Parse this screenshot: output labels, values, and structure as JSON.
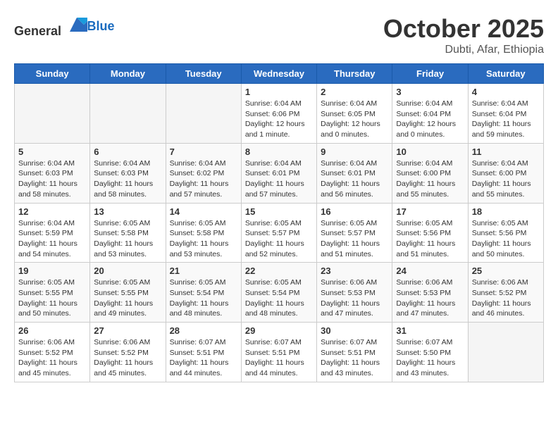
{
  "header": {
    "logo_general": "General",
    "logo_blue": "Blue",
    "month_title": "October 2025",
    "location": "Dubti, Afar, Ethiopia"
  },
  "days_of_week": [
    "Sunday",
    "Monday",
    "Tuesday",
    "Wednesday",
    "Thursday",
    "Friday",
    "Saturday"
  ],
  "weeks": [
    [
      {
        "day": "",
        "info": ""
      },
      {
        "day": "",
        "info": ""
      },
      {
        "day": "",
        "info": ""
      },
      {
        "day": "1",
        "info": "Sunrise: 6:04 AM\nSunset: 6:06 PM\nDaylight: 12 hours\nand 1 minute."
      },
      {
        "day": "2",
        "info": "Sunrise: 6:04 AM\nSunset: 6:05 PM\nDaylight: 12 hours\nand 0 minutes."
      },
      {
        "day": "3",
        "info": "Sunrise: 6:04 AM\nSunset: 6:04 PM\nDaylight: 12 hours\nand 0 minutes."
      },
      {
        "day": "4",
        "info": "Sunrise: 6:04 AM\nSunset: 6:04 PM\nDaylight: 11 hours\nand 59 minutes."
      }
    ],
    [
      {
        "day": "5",
        "info": "Sunrise: 6:04 AM\nSunset: 6:03 PM\nDaylight: 11 hours\nand 58 minutes."
      },
      {
        "day": "6",
        "info": "Sunrise: 6:04 AM\nSunset: 6:03 PM\nDaylight: 11 hours\nand 58 minutes."
      },
      {
        "day": "7",
        "info": "Sunrise: 6:04 AM\nSunset: 6:02 PM\nDaylight: 11 hours\nand 57 minutes."
      },
      {
        "day": "8",
        "info": "Sunrise: 6:04 AM\nSunset: 6:01 PM\nDaylight: 11 hours\nand 57 minutes."
      },
      {
        "day": "9",
        "info": "Sunrise: 6:04 AM\nSunset: 6:01 PM\nDaylight: 11 hours\nand 56 minutes."
      },
      {
        "day": "10",
        "info": "Sunrise: 6:04 AM\nSunset: 6:00 PM\nDaylight: 11 hours\nand 55 minutes."
      },
      {
        "day": "11",
        "info": "Sunrise: 6:04 AM\nSunset: 6:00 PM\nDaylight: 11 hours\nand 55 minutes."
      }
    ],
    [
      {
        "day": "12",
        "info": "Sunrise: 6:04 AM\nSunset: 5:59 PM\nDaylight: 11 hours\nand 54 minutes."
      },
      {
        "day": "13",
        "info": "Sunrise: 6:05 AM\nSunset: 5:58 PM\nDaylight: 11 hours\nand 53 minutes."
      },
      {
        "day": "14",
        "info": "Sunrise: 6:05 AM\nSunset: 5:58 PM\nDaylight: 11 hours\nand 53 minutes."
      },
      {
        "day": "15",
        "info": "Sunrise: 6:05 AM\nSunset: 5:57 PM\nDaylight: 11 hours\nand 52 minutes."
      },
      {
        "day": "16",
        "info": "Sunrise: 6:05 AM\nSunset: 5:57 PM\nDaylight: 11 hours\nand 51 minutes."
      },
      {
        "day": "17",
        "info": "Sunrise: 6:05 AM\nSunset: 5:56 PM\nDaylight: 11 hours\nand 51 minutes."
      },
      {
        "day": "18",
        "info": "Sunrise: 6:05 AM\nSunset: 5:56 PM\nDaylight: 11 hours\nand 50 minutes."
      }
    ],
    [
      {
        "day": "19",
        "info": "Sunrise: 6:05 AM\nSunset: 5:55 PM\nDaylight: 11 hours\nand 50 minutes."
      },
      {
        "day": "20",
        "info": "Sunrise: 6:05 AM\nSunset: 5:55 PM\nDaylight: 11 hours\nand 49 minutes."
      },
      {
        "day": "21",
        "info": "Sunrise: 6:05 AM\nSunset: 5:54 PM\nDaylight: 11 hours\nand 48 minutes."
      },
      {
        "day": "22",
        "info": "Sunrise: 6:05 AM\nSunset: 5:54 PM\nDaylight: 11 hours\nand 48 minutes."
      },
      {
        "day": "23",
        "info": "Sunrise: 6:06 AM\nSunset: 5:53 PM\nDaylight: 11 hours\nand 47 minutes."
      },
      {
        "day": "24",
        "info": "Sunrise: 6:06 AM\nSunset: 5:53 PM\nDaylight: 11 hours\nand 47 minutes."
      },
      {
        "day": "25",
        "info": "Sunrise: 6:06 AM\nSunset: 5:52 PM\nDaylight: 11 hours\nand 46 minutes."
      }
    ],
    [
      {
        "day": "26",
        "info": "Sunrise: 6:06 AM\nSunset: 5:52 PM\nDaylight: 11 hours\nand 45 minutes."
      },
      {
        "day": "27",
        "info": "Sunrise: 6:06 AM\nSunset: 5:52 PM\nDaylight: 11 hours\nand 45 minutes."
      },
      {
        "day": "28",
        "info": "Sunrise: 6:07 AM\nSunset: 5:51 PM\nDaylight: 11 hours\nand 44 minutes."
      },
      {
        "day": "29",
        "info": "Sunrise: 6:07 AM\nSunset: 5:51 PM\nDaylight: 11 hours\nand 44 minutes."
      },
      {
        "day": "30",
        "info": "Sunrise: 6:07 AM\nSunset: 5:51 PM\nDaylight: 11 hours\nand 43 minutes."
      },
      {
        "day": "31",
        "info": "Sunrise: 6:07 AM\nSunset: 5:50 PM\nDaylight: 11 hours\nand 43 minutes."
      },
      {
        "day": "",
        "info": ""
      }
    ]
  ]
}
